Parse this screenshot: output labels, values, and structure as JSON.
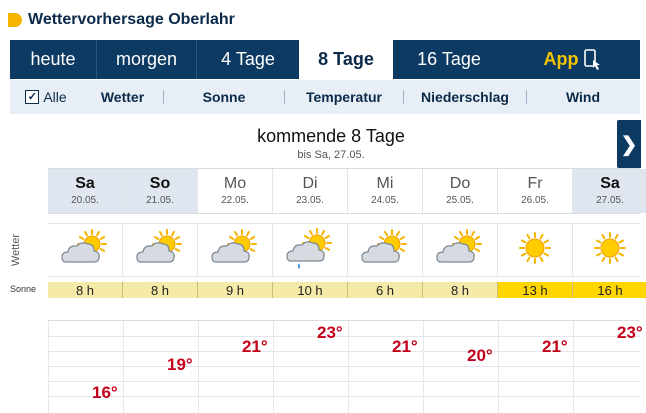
{
  "header": {
    "title": "Wettervorhersage Oberlahr"
  },
  "tabs": [
    {
      "label": "heute"
    },
    {
      "label": "morgen"
    },
    {
      "label": "4 Tage"
    },
    {
      "label": "8 Tage",
      "active": true
    },
    {
      "label": "16 Tage"
    }
  ],
  "app": {
    "label": "App"
  },
  "filters": {
    "all_label": "Alle",
    "all_checked": true,
    "items": [
      "Wetter",
      "Sonne",
      "Temperatur",
      "Niederschlag",
      "Wind"
    ]
  },
  "period": {
    "title": "kommende 8 Tage",
    "subtitle": "bis Sa, 27.05."
  },
  "rows": {
    "weather_label": "Wetter",
    "sun_label": "Sonne"
  },
  "days": [
    {
      "name": "Sa",
      "date": "20.05.",
      "weekend": true,
      "icon": "partly-cloudy-icon",
      "sun": "8 h",
      "sun_level": "low",
      "temp": "16°"
    },
    {
      "name": "So",
      "date": "21.05.",
      "weekend": true,
      "icon": "partly-cloudy-icon",
      "sun": "8 h",
      "sun_level": "low",
      "temp": "19°"
    },
    {
      "name": "Mo",
      "date": "22.05.",
      "weekend": false,
      "icon": "partly-cloudy-icon",
      "sun": "9 h",
      "sun_level": "low",
      "temp": "21°"
    },
    {
      "name": "Di",
      "date": "23.05.",
      "weekend": false,
      "icon": "cloud-rain-sun-icon",
      "sun": "10 h",
      "sun_level": "low",
      "temp": "23°"
    },
    {
      "name": "Mi",
      "date": "24.05.",
      "weekend": false,
      "icon": "partly-cloudy-icon",
      "sun": "6 h",
      "sun_level": "low",
      "temp": "21°"
    },
    {
      "name": "Do",
      "date": "25.05.",
      "weekend": false,
      "icon": "partly-cloudy-icon",
      "sun": "8 h",
      "sun_level": "low",
      "temp": "20°"
    },
    {
      "name": "Fr",
      "date": "26.05.",
      "weekend": false,
      "icon": "sun-icon",
      "sun": "13 h",
      "sun_level": "high",
      "temp": "21°"
    },
    {
      "name": "Sa",
      "date": "27.05.",
      "weekend": true,
      "icon": "sun-icon",
      "sun": "16 h",
      "sun_level": "high",
      "temp": "23°"
    }
  ],
  "colors": {
    "nav": "#0c3a63",
    "accent": "#f5c400",
    "temp": "#c4001a",
    "sun_high": "#ffd600",
    "sun_low": "#f6eaa8"
  }
}
